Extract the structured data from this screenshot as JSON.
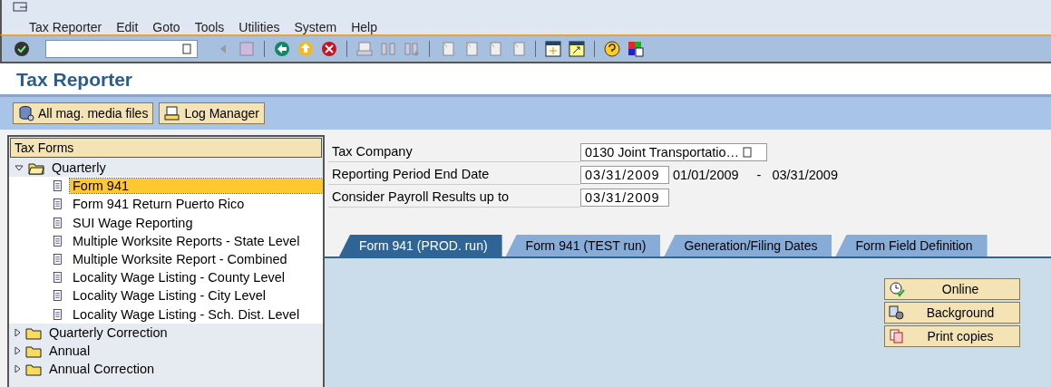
{
  "menu_bar": [
    "Tax Reporter",
    "Edit",
    "Goto",
    "Tools",
    "Utilities",
    "System",
    "Help"
  ],
  "title": "Tax Reporter",
  "app_toolbar": [
    {
      "label": "All mag. media files",
      "kind": "media"
    },
    {
      "label": "Log Manager",
      "kind": "log"
    }
  ],
  "tree": {
    "title": "Tax Forms",
    "nodes": [
      {
        "label": "Quarterly",
        "expanded": true,
        "children": [
          {
            "label": "Form 941",
            "selected": true
          },
          {
            "label": "Form 941 Return Puerto Rico",
            "selected": false
          },
          {
            "label": "SUI Wage Reporting",
            "selected": false
          },
          {
            "label": "Multiple Worksite Reports - State Level",
            "selected": false
          },
          {
            "label": "Multiple Worksite Report - Combined",
            "selected": false
          },
          {
            "label": "Locality Wage Listing - County Level",
            "selected": false
          },
          {
            "label": "Locality Wage Listing - City Level",
            "selected": false
          },
          {
            "label": "Locality Wage Listing - Sch. Dist. Level",
            "selected": false
          }
        ]
      },
      {
        "label": "Quarterly Correction",
        "expanded": false
      },
      {
        "label": "Annual",
        "expanded": false
      },
      {
        "label": "Annual Correction",
        "expanded": false
      }
    ]
  },
  "fields": [
    {
      "label": "Tax Company",
      "value": "0130 Joint Transportatio…",
      "kind": "lookup"
    },
    {
      "label": "Reporting Period End Date",
      "value": "03/31/2009",
      "kind": "date",
      "range_from": "01/01/2009",
      "range_sep": "-",
      "range_to": "03/31/2009"
    },
    {
      "label": "Consider Payroll Results up to",
      "value": "03/31/2009",
      "kind": "date"
    }
  ],
  "tabs": [
    {
      "label": "Form 941 (PROD. run)",
      "selected": true
    },
    {
      "label": "Form 941 (TEST run)",
      "selected": false
    },
    {
      "label": "Generation/Filing Dates",
      "selected": false
    },
    {
      "label": "Form Field Definition",
      "selected": false
    }
  ],
  "run_buttons": [
    {
      "label": "Online",
      "kind": "online"
    },
    {
      "label": "Background",
      "kind": "background"
    },
    {
      "label": "Print copies",
      "kind": "print"
    }
  ]
}
